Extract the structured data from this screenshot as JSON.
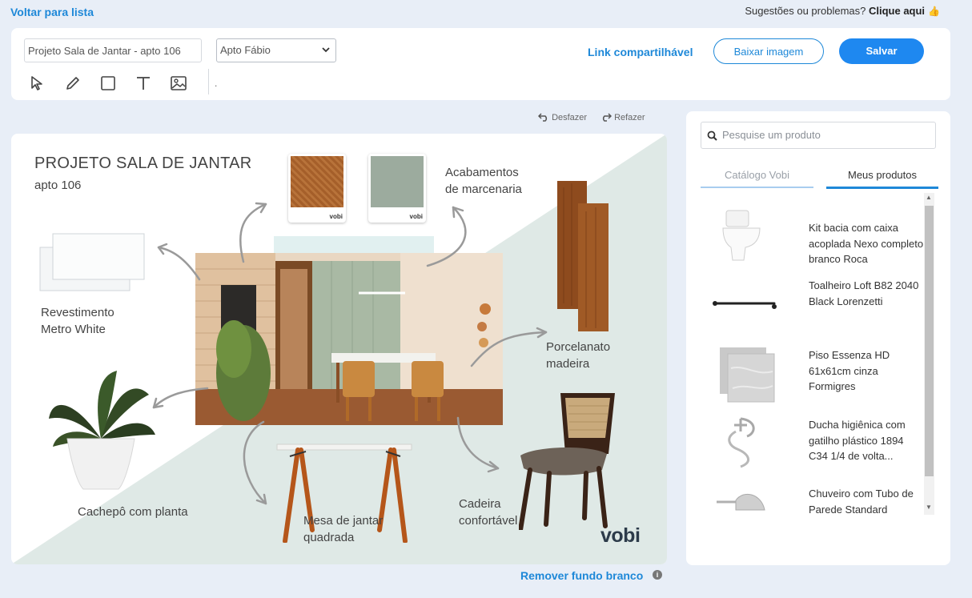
{
  "nav": {
    "back_label": "Voltar para lista"
  },
  "feedback": {
    "question": "Sugestões ou problemas?",
    "link": "Clique aqui"
  },
  "toolbar": {
    "project_name": "Projeto Sala de Jantar - apto 106",
    "owner_selected": "Apto Fábio",
    "share_link": "Link compartilhável",
    "download_label": "Baixar imagem",
    "save_label": "Salvar",
    "separator_text": ".",
    "tools": [
      "select-arrow-icon",
      "pencil-icon",
      "rectangle-icon",
      "text-icon",
      "image-icon"
    ]
  },
  "history": {
    "undo": "Desfazer",
    "redo": "Refazer"
  },
  "board": {
    "title": "PROJETO SALA DE JANTAR",
    "subtitle": "apto 106",
    "labels": {
      "finishes_1": "Acabamentos",
      "finishes_2": "de marcenaria",
      "tile_1": "Revestimento",
      "tile_2": "Metro White",
      "porcelain_1": "Porcelanato",
      "porcelain_2": "madeira",
      "planter": "Cachepô com planta",
      "table_1": "Mesa de jantar",
      "table_2": "quadrada",
      "chair_1": "Cadeira",
      "chair_2": "confortável"
    },
    "swatch_brand": "vobi",
    "logo": "vobi"
  },
  "remove_bg": "Remover fundo branco",
  "panel": {
    "search_placeholder": "Pesquise um produto",
    "tabs": [
      "Catálogo Vobi",
      "Meus produtos"
    ],
    "active_tab": "Meus produtos",
    "products": [
      {
        "name": "Kit bacia com caixa acoplada Nexo completo branco Roca",
        "icon": "toilet-icon"
      },
      {
        "name": "Toalheiro Loft B82 2040 Black Lorenzetti",
        "icon": "towel-bar-icon"
      },
      {
        "name": "Piso Essenza HD 61x61cm cinza Formigres",
        "icon": "floor-tile-icon"
      },
      {
        "name": "Ducha higiênica com gatilho plástico 1894 C34 1/4 de volta...",
        "icon": "hygienic-shower-icon"
      },
      {
        "name": "Chuveiro com Tubo de Parede Standard",
        "icon": "shower-icon"
      }
    ]
  },
  "colors": {
    "accent": "#1e88d8",
    "save": "#1e88f0",
    "board_bg": "#dfe9e6"
  }
}
